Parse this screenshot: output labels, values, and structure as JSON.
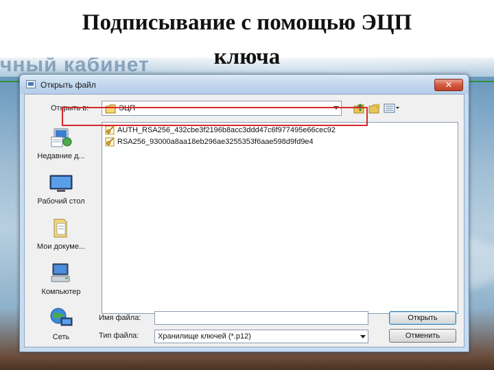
{
  "slide": {
    "title_line1": "Подписывание с помощью  ЭЦП",
    "title_line2": "ключа"
  },
  "background": {
    "header_text": "чный кабинет"
  },
  "dialog": {
    "title": "Открыть файл",
    "close_label": "✕",
    "look_in_label": "Открыть в:",
    "look_in_value": "ЭЦП",
    "places": [
      {
        "label": "Недавние д...",
        "icon": "recent-documents-icon"
      },
      {
        "label": "Рабочий стол",
        "icon": "desktop-icon"
      },
      {
        "label": "Мои докуме...",
        "icon": "my-documents-icon"
      },
      {
        "label": "Компьютер",
        "icon": "computer-icon"
      },
      {
        "label": "Сеть",
        "icon": "network-icon"
      }
    ],
    "files": [
      {
        "name": "AUTH_RSA256_432cbe3f2196b8acc3ddd47c6f977495e66cec92",
        "icon": "certificate-key-icon"
      },
      {
        "name": "RSA256_93000a8aa18eb296ae3255353f6aae598d9fd9e4",
        "icon": "certificate-key-icon"
      }
    ],
    "file_name_label": "Имя файла:",
    "file_name_value": "",
    "file_type_label": "Тип файла:",
    "file_type_value": "Хранилище ключей (*.p12)",
    "open_button": "Открыть",
    "cancel_button": "Отменить"
  },
  "colors": {
    "highlight": "#d9252b",
    "title_bar": "#c2d7ee",
    "close_button": "#c0412a"
  }
}
